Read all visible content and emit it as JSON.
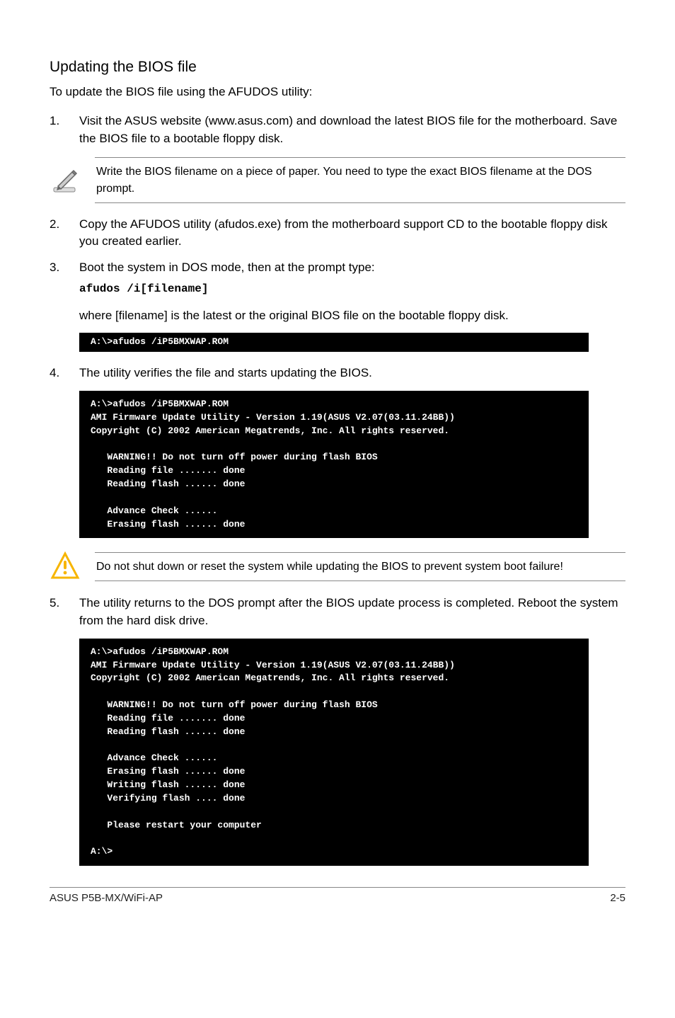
{
  "heading": "Updating the BIOS file",
  "intro": "To update the BIOS file using the AFUDOS utility:",
  "steps": {
    "s1": {
      "num": "1.",
      "text": "Visit the ASUS website (www.asus.com) and download the latest BIOS file for the motherboard. Save the BIOS file to a bootable floppy disk."
    },
    "s2": {
      "num": "2.",
      "text": "Copy the AFUDOS utility (afudos.exe) from the motherboard support CD to the bootable floppy disk you created earlier."
    },
    "s3": {
      "num": "3.",
      "text1": "Boot the system in DOS mode, then at the prompt type:",
      "cmd": "afudos /i[filename]",
      "text2": "where [filename] is the latest or the original BIOS file on the bootable floppy disk."
    },
    "s4": {
      "num": "4.",
      "text": "The utility verifies the file and starts updating the BIOS."
    },
    "s5": {
      "num": "5.",
      "text": "The utility returns to the DOS prompt after the BIOS update process is completed. Reboot the system from the hard disk drive."
    }
  },
  "note1": "Write the BIOS filename on a piece of paper. You need to type the exact BIOS filename at the DOS prompt.",
  "note2": "Do not shut down or reset the system while updating the BIOS to prevent system boot failure!",
  "terminal1": "A:\\>afudos /iP5BMXWAP.ROM",
  "terminal2": "A:\\>afudos /iP5BMXWAP.ROM\nAMI Firmware Update Utility - Version 1.19(ASUS V2.07(03.11.24BB))\nCopyright (C) 2002 American Megatrends, Inc. All rights reserved.\n\n   WARNING!! Do not turn off power during flash BIOS\n   Reading file ....... done\n   Reading flash ...... done\n\n   Advance Check ......\n   Erasing flash ...... done",
  "terminal3": "A:\\>afudos /iP5BMXWAP.ROM\nAMI Firmware Update Utility - Version 1.19(ASUS V2.07(03.11.24BB))\nCopyright (C) 2002 American Megatrends, Inc. All rights reserved.\n\n   WARNING!! Do not turn off power during flash BIOS\n   Reading file ....... done\n   Reading flash ...... done\n\n   Advance Check ......\n   Erasing flash ...... done\n   Writing flash ...... done\n   Verifying flash .... done\n\n   Please restart your computer\n\nA:\\>",
  "footer": {
    "left": "ASUS P5B-MX/WiFi-AP",
    "right": "2-5"
  }
}
